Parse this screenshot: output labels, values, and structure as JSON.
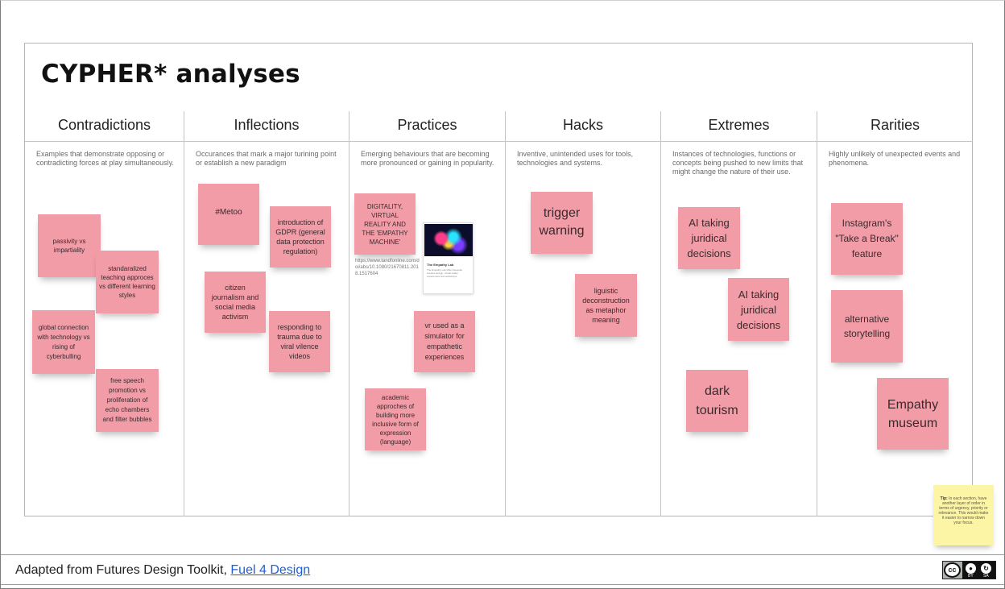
{
  "board": {
    "title": "CYPHER* analyses"
  },
  "columns": [
    {
      "name": "Contradictions",
      "desc": "Examples that demonstrate opposing or contradicting forces at play simultaneously."
    },
    {
      "name": "Inflections",
      "desc": "Occurances that mark a major turining point or establish a new paradigm"
    },
    {
      "name": "Practices",
      "desc": "Emerging behaviours that are becoming more pronounced or gaining in popularity."
    },
    {
      "name": "Hacks",
      "desc": "Inventive, unintended uses for tools, technologies and systems."
    },
    {
      "name": "Extremes",
      "desc": "Instances of technologies, functions or concepts being pushed to new limits that might change the nature of their use."
    },
    {
      "name": "Rarities",
      "desc": "Highly unlikely of unexpected events and phenomena."
    }
  ],
  "notes": {
    "contradictions": [
      "passivity vs impartiality",
      "standaralized teaching approces vs different learning styles",
      "global connection with technology vs rising of cyberbulling",
      "free speech promotion vs proliferation of echo chambers and filter bubbles"
    ],
    "inflections": [
      "#Metoo",
      "introduction of GDPR (general data protection regulation)",
      "citizen journalism and social media activism",
      "responding to trauma due to viral vilence videos"
    ],
    "practices": [
      "DIGITALITY, VIRTUAL REALITY AND THE 'EMPATHY MACHINE'",
      "vr used as a simulator for empathetic experiences",
      "academic approches of building more inclusive form of expression (language)"
    ],
    "hacks": [
      "trigger warning",
      "liguistic deconstruction as metaphor meaning"
    ],
    "extremes": [
      "AI taking juridical decisions",
      "AI taking juridical decisions",
      "dark tourism"
    ],
    "rarities": [
      "Instagram's \"Take a Break\" feature",
      "alternative storytelling",
      "Empathy museum"
    ]
  },
  "link_card": {
    "url": "https://www.tandfonline.com/doi/abs/10.1080/21670811.2018.1517604",
    "title": "The Empathy Lab",
    "text": "The Empathy Lab offers bespoke creative design, virtual reality experiences and workshops."
  },
  "tip": {
    "label": "Tip:",
    "text": "In each section, have another layer of order in terms of urgency, priority or relevance. This would make it easier to narrow down your focus."
  },
  "footer": {
    "text": "Adapted from Futures Design Toolkit,",
    "link": "Fuel 4 Design"
  },
  "license": {
    "cc": "cc",
    "by": "BY",
    "sa": "SA"
  },
  "colors": {
    "note_pink": "#f29ca7",
    "tip_yellow": "#fdf5a6",
    "link_blue": "#1f5fd6"
  }
}
